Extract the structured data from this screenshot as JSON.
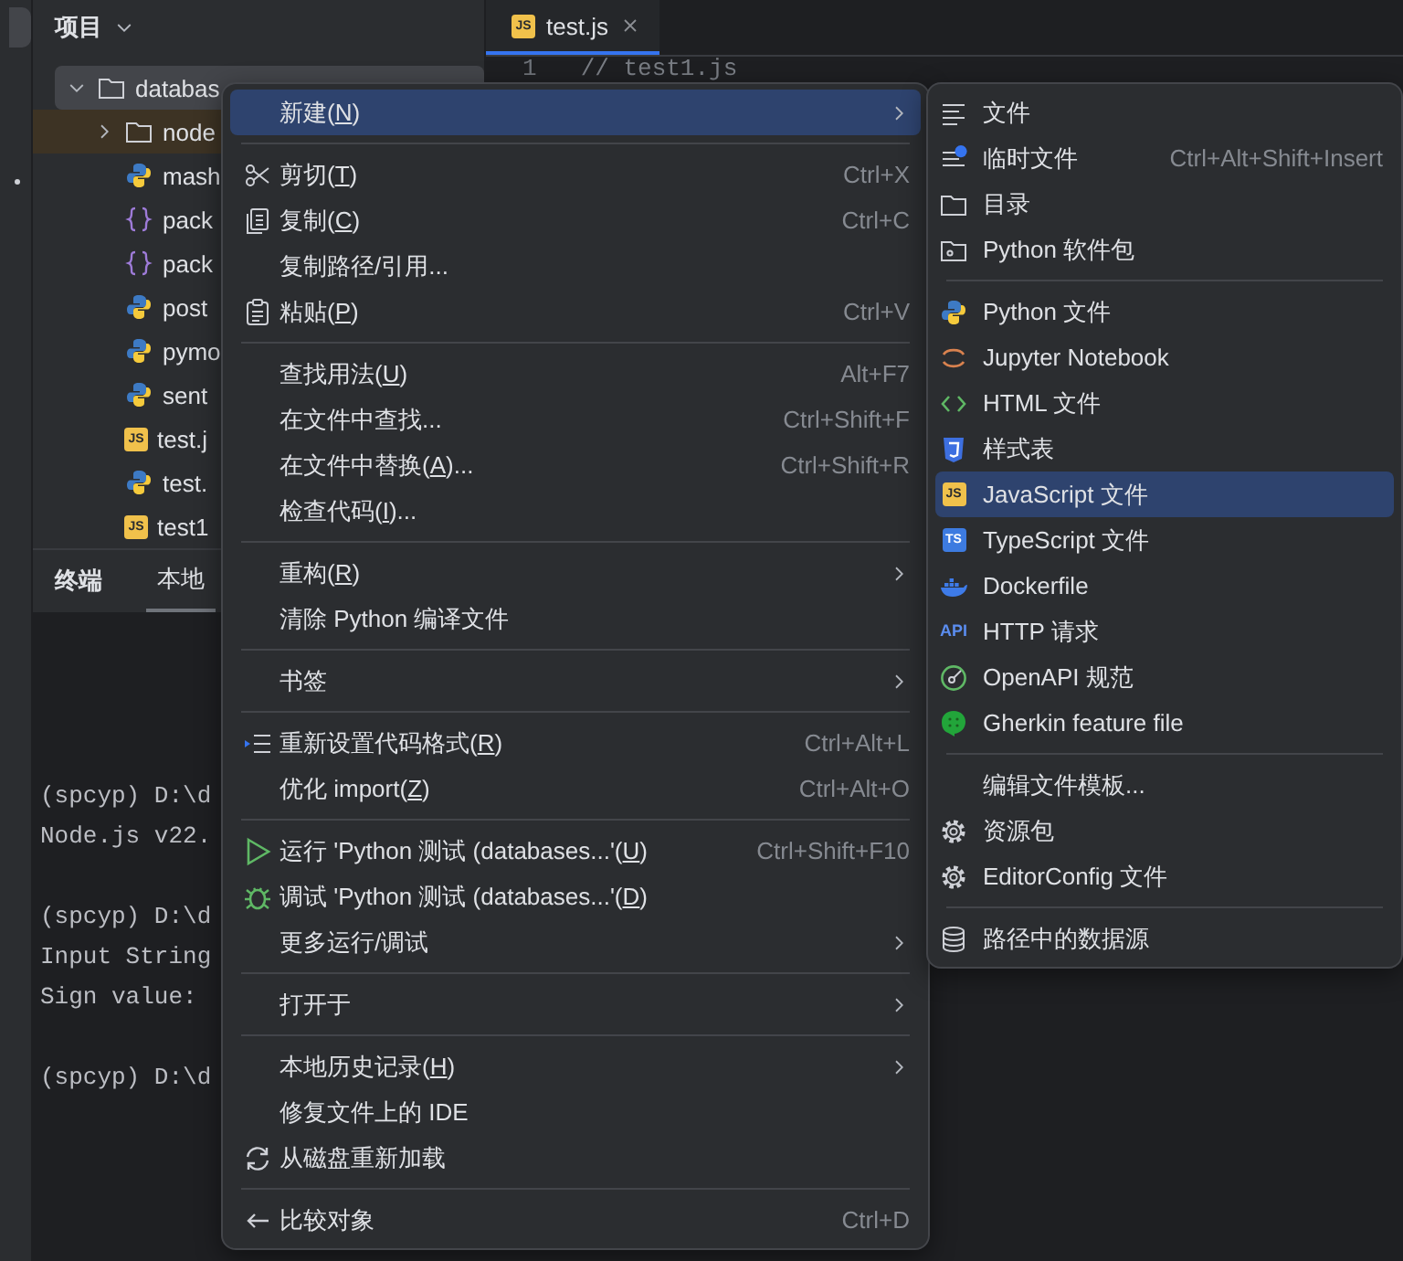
{
  "project": {
    "title": "项目",
    "tree": [
      {
        "label": "databas",
        "kind": "folder",
        "expanded": true,
        "selected": true,
        "highlighted": false,
        "children": [
          {
            "label": "node",
            "kind": "folder",
            "expanded": false,
            "selected": false,
            "highlighted": true
          },
          {
            "label": "mash",
            "kind": "python",
            "selected": false,
            "highlighted": false
          },
          {
            "label": "pack",
            "kind": "json",
            "selected": false,
            "highlighted": false
          },
          {
            "label": "pack",
            "kind": "json",
            "selected": false,
            "highlighted": false
          },
          {
            "label": "post",
            "kind": "python",
            "selected": false,
            "highlighted": false
          },
          {
            "label": "pymo",
            "kind": "python",
            "selected": false,
            "highlighted": false
          },
          {
            "label": "sent",
            "kind": "python",
            "selected": false,
            "highlighted": false
          },
          {
            "label": "test.j",
            "kind": "js",
            "icon_text": "JS",
            "selected": false,
            "highlighted": false
          },
          {
            "label": "test.",
            "kind": "python",
            "selected": false,
            "highlighted": false
          },
          {
            "label": "test1",
            "kind": "js",
            "icon_text": "JS",
            "selected": false,
            "highlighted": false
          }
        ]
      }
    ]
  },
  "editor": {
    "tabs": [
      {
        "label": "test.js",
        "kind": "js",
        "icon_text": "JS",
        "selected": true
      }
    ],
    "lines": [
      {
        "number": "1",
        "code": "// test1.js"
      }
    ]
  },
  "terminal": {
    "title": "终端",
    "tabs": [
      {
        "label": "本地",
        "selected": true
      }
    ],
    "blocks": [
      [
        "(spcyp) D:\\d",
        "Node.js v22."
      ],
      [
        "(spcyp) D:\\d",
        "Input String",
        "Sign value:"
      ],
      [
        "(spcyp) D:\\d"
      ]
    ]
  },
  "context_menu": {
    "groups": [
      [
        {
          "text": "新建(",
          "mnemonic": "N",
          "text_after": ")",
          "submenu": true,
          "selected": true
        }
      ],
      [
        {
          "kind": "scissors",
          "text": "剪切(",
          "mnemonic": "T",
          "text_after": ")",
          "shortcut": "Ctrl+X",
          "submenu": false,
          "selected": false
        },
        {
          "kind": "copy",
          "text": "复制(",
          "mnemonic": "C",
          "text_after": ")",
          "shortcut": "Ctrl+C",
          "submenu": false,
          "selected": false
        },
        {
          "text": "复制路径/引用...",
          "submenu": false,
          "selected": false
        },
        {
          "kind": "paste",
          "text": "粘贴(",
          "mnemonic": "P",
          "text_after": ")",
          "shortcut": "Ctrl+V",
          "submenu": false,
          "selected": false
        }
      ],
      [
        {
          "text": "查找用法(",
          "mnemonic": "U",
          "text_after": ")",
          "shortcut": "Alt+F7",
          "submenu": false,
          "selected": false
        },
        {
          "text": "在文件中查找...",
          "shortcut": "Ctrl+Shift+F",
          "submenu": false,
          "selected": false
        },
        {
          "text": "在文件中替换(",
          "mnemonic": "A",
          "text_after": ")...",
          "shortcut": "Ctrl+Shift+R",
          "submenu": false,
          "selected": false
        },
        {
          "text": "检查代码(",
          "mnemonic": "I",
          "text_after": ")...",
          "submenu": false,
          "selected": false
        }
      ],
      [
        {
          "text": "重构(",
          "mnemonic": "R",
          "text_after": ")",
          "submenu": true,
          "selected": false
        },
        {
          "text": "清除 Python 编译文件",
          "submenu": false,
          "selected": false
        }
      ],
      [
        {
          "text": "书签",
          "submenu": true,
          "selected": false
        }
      ],
      [
        {
          "kind": "format",
          "text": "重新设置代码格式(",
          "mnemonic": "R",
          "text_after": ")",
          "shortcut": "Ctrl+Alt+L",
          "submenu": false,
          "selected": false
        },
        {
          "text": "优化 import(",
          "mnemonic": "Z",
          "text_after": ")",
          "shortcut": "Ctrl+Alt+O",
          "submenu": false,
          "selected": false
        }
      ],
      [
        {
          "kind": "run",
          "text": "运行 'Python 测试 (databases...'(",
          "mnemonic": "U",
          "text_after": ")",
          "shortcut": "Ctrl+Shift+F10",
          "submenu": false,
          "selected": false
        },
        {
          "kind": "debug",
          "text": "调试 'Python 测试 (databases...'(",
          "mnemonic": "D",
          "text_after": ")",
          "submenu": false,
          "selected": false
        },
        {
          "text": "更多运行/调试",
          "submenu": true,
          "selected": false
        }
      ],
      [
        {
          "text": "打开于",
          "submenu": true,
          "selected": false
        }
      ],
      [
        {
          "text": "本地历史记录(",
          "mnemonic": "H",
          "text_after": ")",
          "submenu": true,
          "selected": false
        },
        {
          "text": "修复文件上的 IDE",
          "submenu": false,
          "selected": false
        },
        {
          "kind": "reload",
          "text": "从磁盘重新加载",
          "submenu": false,
          "selected": false
        }
      ],
      [
        {
          "kind": "compare",
          "text": "比较对象",
          "shortcut": "Ctrl+D",
          "submenu": false,
          "selected": false
        }
      ]
    ]
  },
  "submenu": {
    "groups": [
      [
        {
          "kind": "lines",
          "text": "文件",
          "selected": false
        },
        {
          "kind": "scratch",
          "text": "临时文件",
          "shortcut": "Ctrl+Alt+Shift+Insert",
          "selected": false
        },
        {
          "kind": "folder",
          "text": "目录",
          "selected": false
        },
        {
          "kind": "package",
          "text": "Python 软件包",
          "selected": false
        }
      ],
      [
        {
          "kind": "python",
          "text": "Python 文件",
          "selected": false
        },
        {
          "kind": "jupyter",
          "text": "Jupyter Notebook",
          "selected": false
        },
        {
          "kind": "html",
          "text": "HTML 文件",
          "selected": false
        },
        {
          "kind": "css",
          "text": "样式表",
          "selected": false
        },
        {
          "kind": "js",
          "icon_text": "JS",
          "text": "JavaScript 文件",
          "selected": true
        },
        {
          "kind": "ts",
          "icon_text": "TS",
          "text": "TypeScript 文件",
          "selected": false
        },
        {
          "kind": "docker",
          "text": "Dockerfile",
          "selected": false
        },
        {
          "kind": "api",
          "icon_text": "API",
          "text": "HTTP 请求",
          "selected": false
        },
        {
          "kind": "openapi",
          "text": "OpenAPI 规范",
          "selected": false
        },
        {
          "kind": "gherkin",
          "text": "Gherkin feature file",
          "selected": false
        }
      ],
      [
        {
          "text": "编辑文件模板...",
          "selected": false
        },
        {
          "kind": "gear",
          "text": "资源包",
          "selected": false
        },
        {
          "kind": "gear",
          "text": "EditorConfig 文件",
          "selected": false
        }
      ],
      [
        {
          "kind": "database",
          "text": "路径中的数据源",
          "selected": false
        }
      ]
    ]
  }
}
